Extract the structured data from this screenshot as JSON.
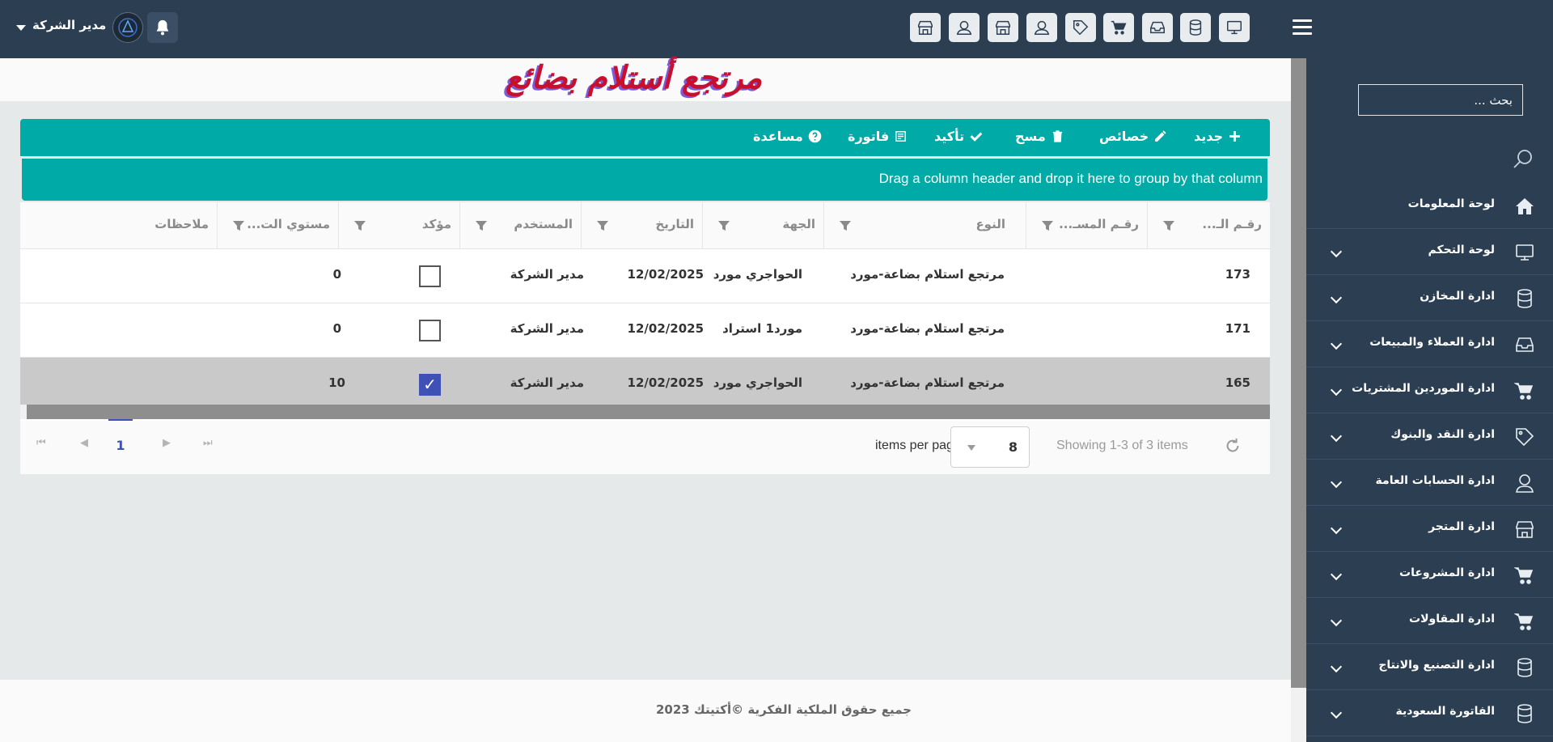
{
  "header": {
    "user_name": "مدير الشركة",
    "toolbar_icons": [
      "monitor-icon",
      "database-icon",
      "inbox-icon",
      "cart-icon",
      "tag-icon",
      "user-icon",
      "store-icon",
      "user-icon",
      "store-icon"
    ]
  },
  "sidebar": {
    "search_placeholder": "بحث ...",
    "items": [
      {
        "label": "لوحة المعلومات",
        "icon": "home-icon",
        "expandable": false
      },
      {
        "label": "لوحة التحكم",
        "icon": "monitor-icon",
        "expandable": true
      },
      {
        "label": "ادارة المخازن",
        "icon": "database-icon",
        "expandable": true
      },
      {
        "label": "ادارة العملاء والمبيعات",
        "icon": "inbox-icon",
        "expandable": true
      },
      {
        "label": "ادارة الموردين المشتريات",
        "icon": "cart-icon",
        "expandable": true
      },
      {
        "label": "ادارة النقد والبنوك",
        "icon": "tag-icon",
        "expandable": true
      },
      {
        "label": "ادارة الحسابات العامة",
        "icon": "user-icon",
        "expandable": true
      },
      {
        "label": "ادارة المتجر",
        "icon": "store-icon",
        "expandable": true
      },
      {
        "label": "ادارة المشروعات",
        "icon": "cart-icon",
        "expandable": true
      },
      {
        "label": "ادارة المقاولات",
        "icon": "cart-icon",
        "expandable": true
      },
      {
        "label": "ادارة التصنيع والانتاج",
        "icon": "database-icon",
        "expandable": true
      },
      {
        "label": "الفاتورة السعودية",
        "icon": "database-icon",
        "expandable": true
      }
    ]
  },
  "page": {
    "title": "مرتجع أستلام بضائع"
  },
  "toolbar": {
    "new": "جديد",
    "properties": "خصائص",
    "delete": "مسح",
    "confirm": "تأكيد",
    "invoice": "فاتورة",
    "help": "مساعدة"
  },
  "grid": {
    "group_hint": "Drag a column header and drop it here to group by that column",
    "columns": [
      "رقـم الـ...",
      "رقـم المسـ...",
      "النوع",
      "الجهة",
      "التاريخ",
      "المستخدم",
      "مؤكد",
      "مستوي الت...",
      "ملاحظات"
    ],
    "rows": [
      {
        "id": "173",
        "ref": "",
        "type": "مرتجع استلام بضاعة-مورد",
        "party": "الحواجري مورد",
        "date": "12/02/2025",
        "user": "مدير الشركة",
        "confirmed": false,
        "level": "0",
        "notes": "",
        "selected": false
      },
      {
        "id": "171",
        "ref": "",
        "type": "مرتجع استلام بضاعة-مورد",
        "party": "مورد1 استراد",
        "date": "12/02/2025",
        "user": "مدير الشركة",
        "confirmed": false,
        "level": "0",
        "notes": "",
        "selected": false
      },
      {
        "id": "165",
        "ref": "",
        "type": "مرتجع استلام بضاعة-مورد",
        "party": "الحواجري مورد",
        "date": "12/02/2025",
        "user": "مدير الشركة",
        "confirmed": true,
        "level": "10",
        "notes": "",
        "selected": true
      }
    ],
    "pager": {
      "current_page": "1",
      "items_per_page": "8",
      "items_per_page_label": "items per page",
      "showing": "Showing 1-3 of 3 items"
    }
  },
  "footer": {
    "copyright": "جميع حقوق الملكية الفكرية ©أكتيتك 2023"
  },
  "colors": {
    "topbar": "#2b3e52",
    "accent": "#00aaa6",
    "selected_row": "#c9c9c9",
    "checkbox_on": "#3f51b5"
  }
}
